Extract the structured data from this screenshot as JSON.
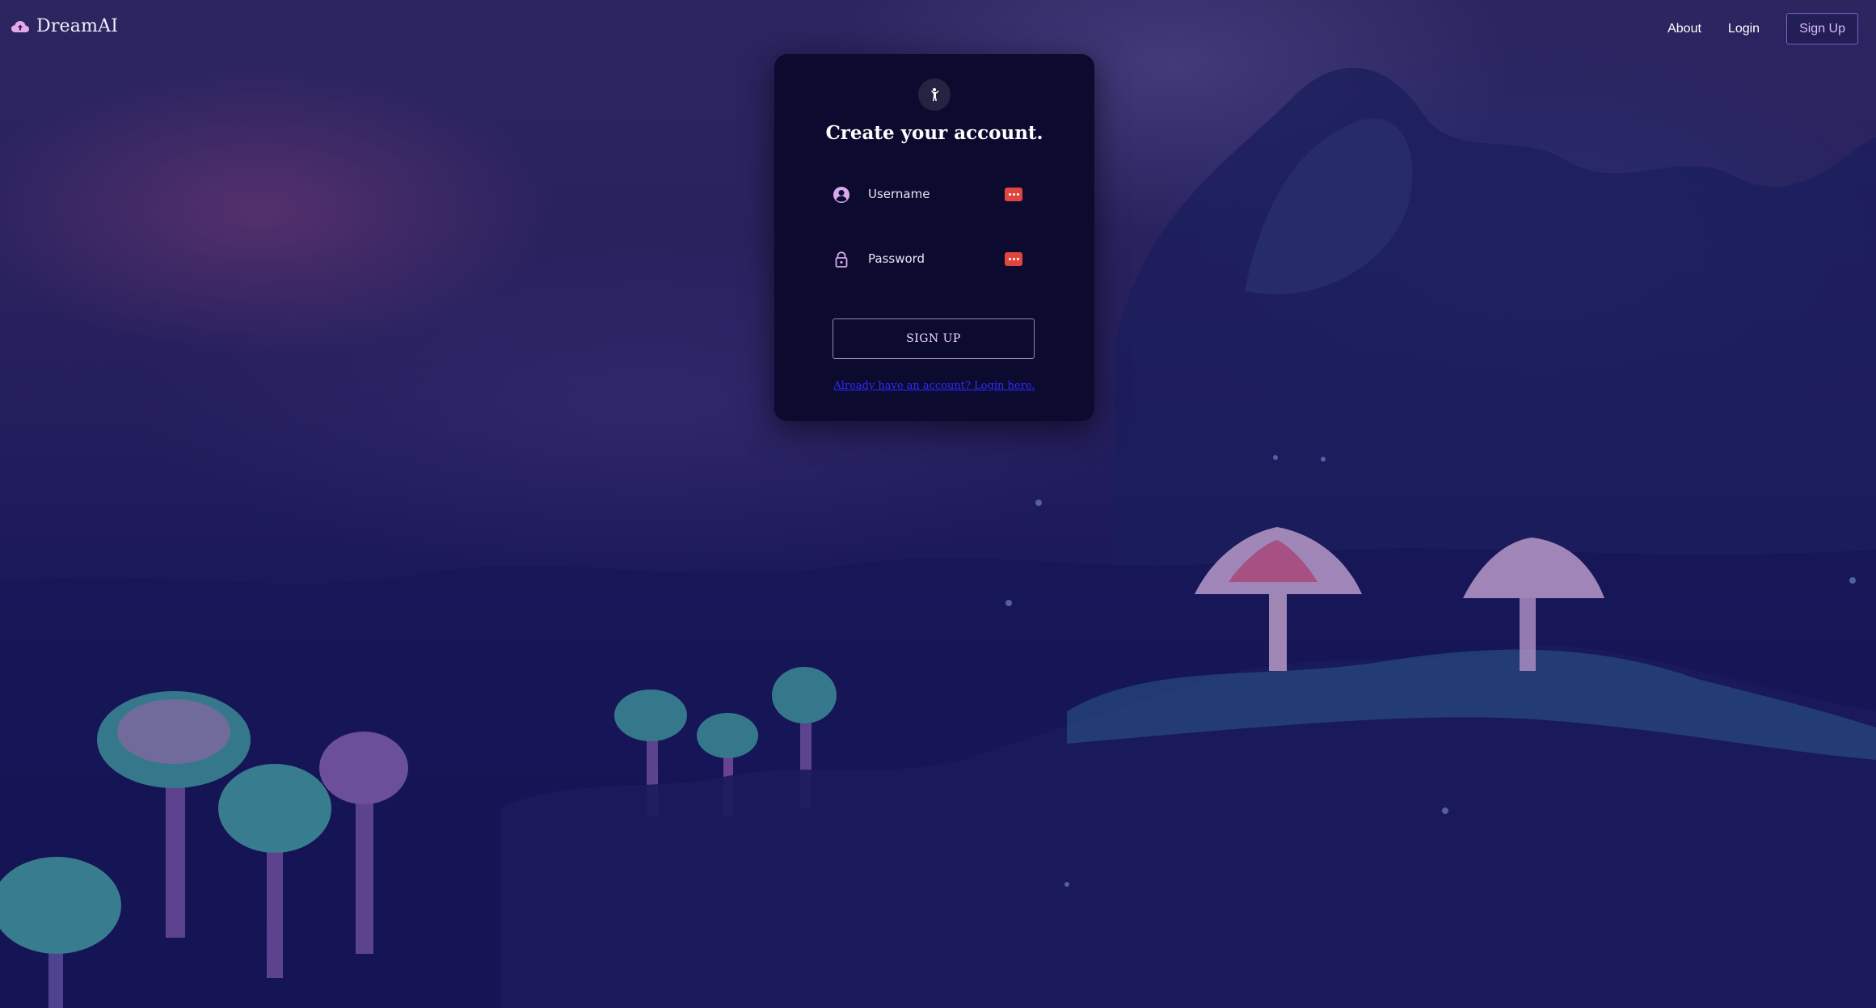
{
  "header": {
    "brand_name": "DreamAI",
    "brand_icon": "cloud-upload-icon",
    "nav": {
      "about": "About",
      "login": "Login",
      "signup": "Sign Up"
    }
  },
  "card": {
    "badge_icon": "person-waving-icon",
    "title": "Create your account.",
    "username": {
      "placeholder": "Username",
      "value": "",
      "icon": "user-circle-icon"
    },
    "password": {
      "placeholder": "Password",
      "value": "",
      "icon": "lock-icon"
    },
    "signup_button": "SIGN UP",
    "login_link": "Already have an account? Login here."
  },
  "colors": {
    "accent": "#d9b8ff",
    "card_bg": "#0c0a2e",
    "link": "#2f2cff",
    "password_manager_badge": "#e0463e"
  }
}
